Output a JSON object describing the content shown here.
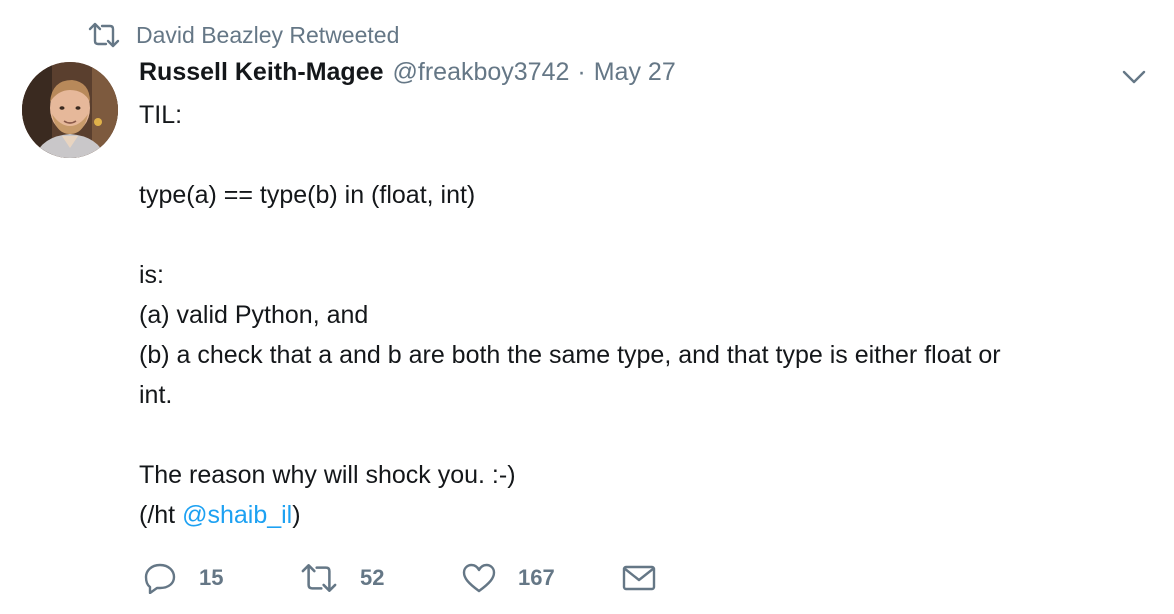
{
  "context": {
    "label": "David Beazley Retweeted",
    "icon": "retweet-icon"
  },
  "author": {
    "fullname": "Russell Keith-Magee",
    "username": "@freakboy3742",
    "separator": "·",
    "time": "May 27"
  },
  "tweet": {
    "lines": [
      "TIL:",
      "",
      "type(a) == type(b) in (float, int)",
      "",
      "is:",
      "(a) valid Python, and",
      "(b) a check that a and b are both the same type, and that type is either float or",
      "int.",
      "",
      "The reason why will shock you. :-)"
    ],
    "last_line_prefix": "(/ht ",
    "mention": "@shaib_il",
    "last_line_suffix": ")"
  },
  "actions": {
    "reply_count": "15",
    "retweet_count": "52",
    "like_count": "167"
  },
  "icons": {
    "caret": "chevron-down-icon",
    "reply": "reply-icon",
    "retweet": "retweet-icon",
    "like": "heart-icon",
    "dm": "envelope-icon"
  },
  "colors": {
    "text": "#14171a",
    "secondary": "#657786",
    "link": "#1da1f2"
  }
}
